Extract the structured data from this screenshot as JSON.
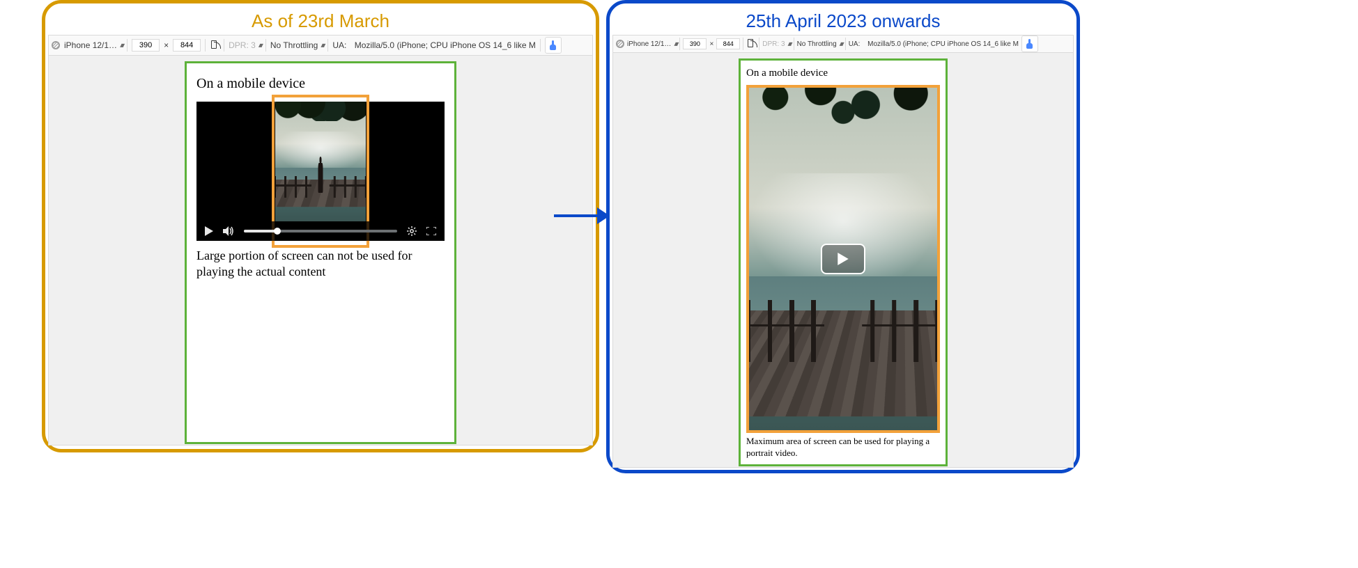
{
  "left": {
    "title": "As of 23rd March",
    "devtools": {
      "device": "iPhone 12/1…",
      "width": "390",
      "dim_sep": "×",
      "height": "844",
      "dpr_label": "DPR: 3",
      "throttle": "No Throttling",
      "ua_label": "UA:",
      "ua_value": "Mozilla/5.0 (iPhone; CPU iPhone OS 14_6 like M"
    },
    "page": {
      "heading": "On a mobile device",
      "caption": "Large portion of screen can not be used for playing the actual content"
    }
  },
  "right": {
    "title": "25th April 2023 onwards",
    "devtools": {
      "device": "iPhone 12/1…",
      "width": "390",
      "dim_sep": "×",
      "height": "844",
      "dpr_label": "DPR: 3",
      "throttle": "No Throttling",
      "ua_label": "UA:",
      "ua_value": "Mozilla/5.0 (iPhone; CPU iPhone OS 14_6 like M"
    },
    "page": {
      "heading": "On a mobile device",
      "caption": "Maximum area of screen can be used for playing a portrait video."
    }
  },
  "icons": {
    "play": "play-icon",
    "volume": "volume-icon",
    "gear": "gear-icon",
    "fullscreen": "fullscreen-icon",
    "touch": "touch-icon",
    "rotate": "rotate-device-icon",
    "no_signal": "no-signal-icon",
    "updown": "updown-icon"
  }
}
